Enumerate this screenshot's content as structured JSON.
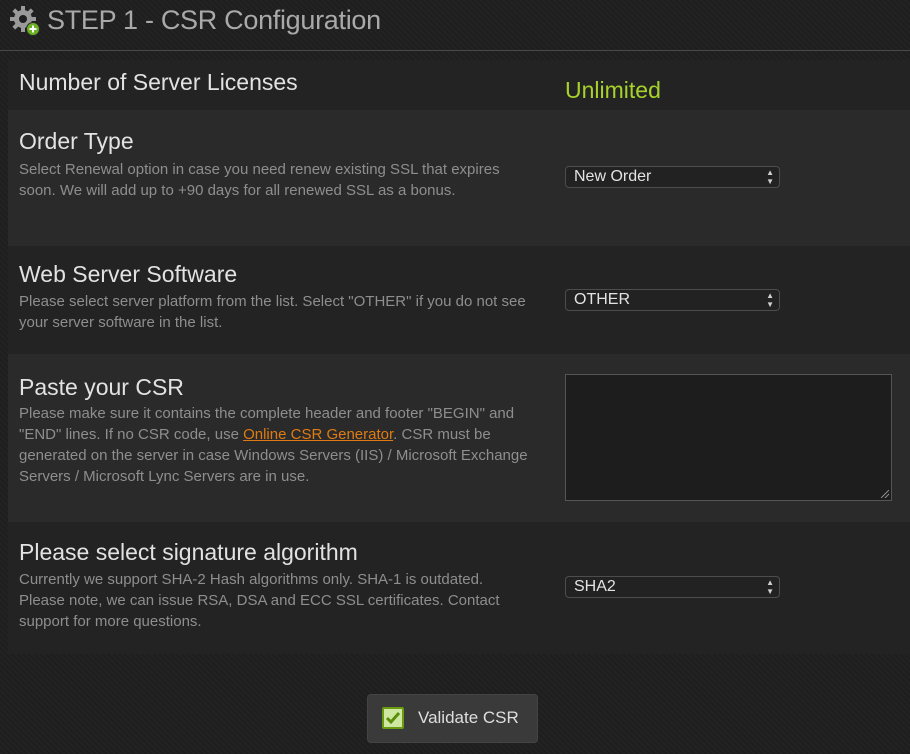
{
  "header": {
    "title": "STEP 1 - CSR Configuration",
    "icon": "gear-icon"
  },
  "licenses": {
    "label": "Number of Server Licenses",
    "value": "Unlimited",
    "value_color": "#a7d22a"
  },
  "order_type": {
    "title": "Order Type",
    "description": "Select Renewal option in case you need renew existing SSL that expires soon. We will add up to +90 days for all renewed SSL as a bonus.",
    "selected": "New Order"
  },
  "web_server": {
    "title": "Web Server Software",
    "description": "Please select server platform from the list. Select \"OTHER\" if you do not see your server software in the list.",
    "selected": "OTHER"
  },
  "csr": {
    "title": "Paste your CSR",
    "desc_before": "Please make sure it contains the complete header and footer \"BEGIN\" and \"END\" lines. If no CSR code, use ",
    "link_text": "Online CSR Generator",
    "desc_after": ". CSR must be generated on the server in case Windows Servers (IIS) / Microsoft Exchange Servers / Microsoft Lync Servers are in use.",
    "link_color": "#e07b12",
    "value": ""
  },
  "signature": {
    "title": "Please select signature algorithm",
    "description": "Currently we support SHA-2 Hash algorithms only. SHA-1 is outdated. Please note, we can issue RSA, DSA and ECC SSL certificates. Contact support for more questions.",
    "selected": "SHA2"
  },
  "validate_button": {
    "label": "Validate CSR"
  }
}
